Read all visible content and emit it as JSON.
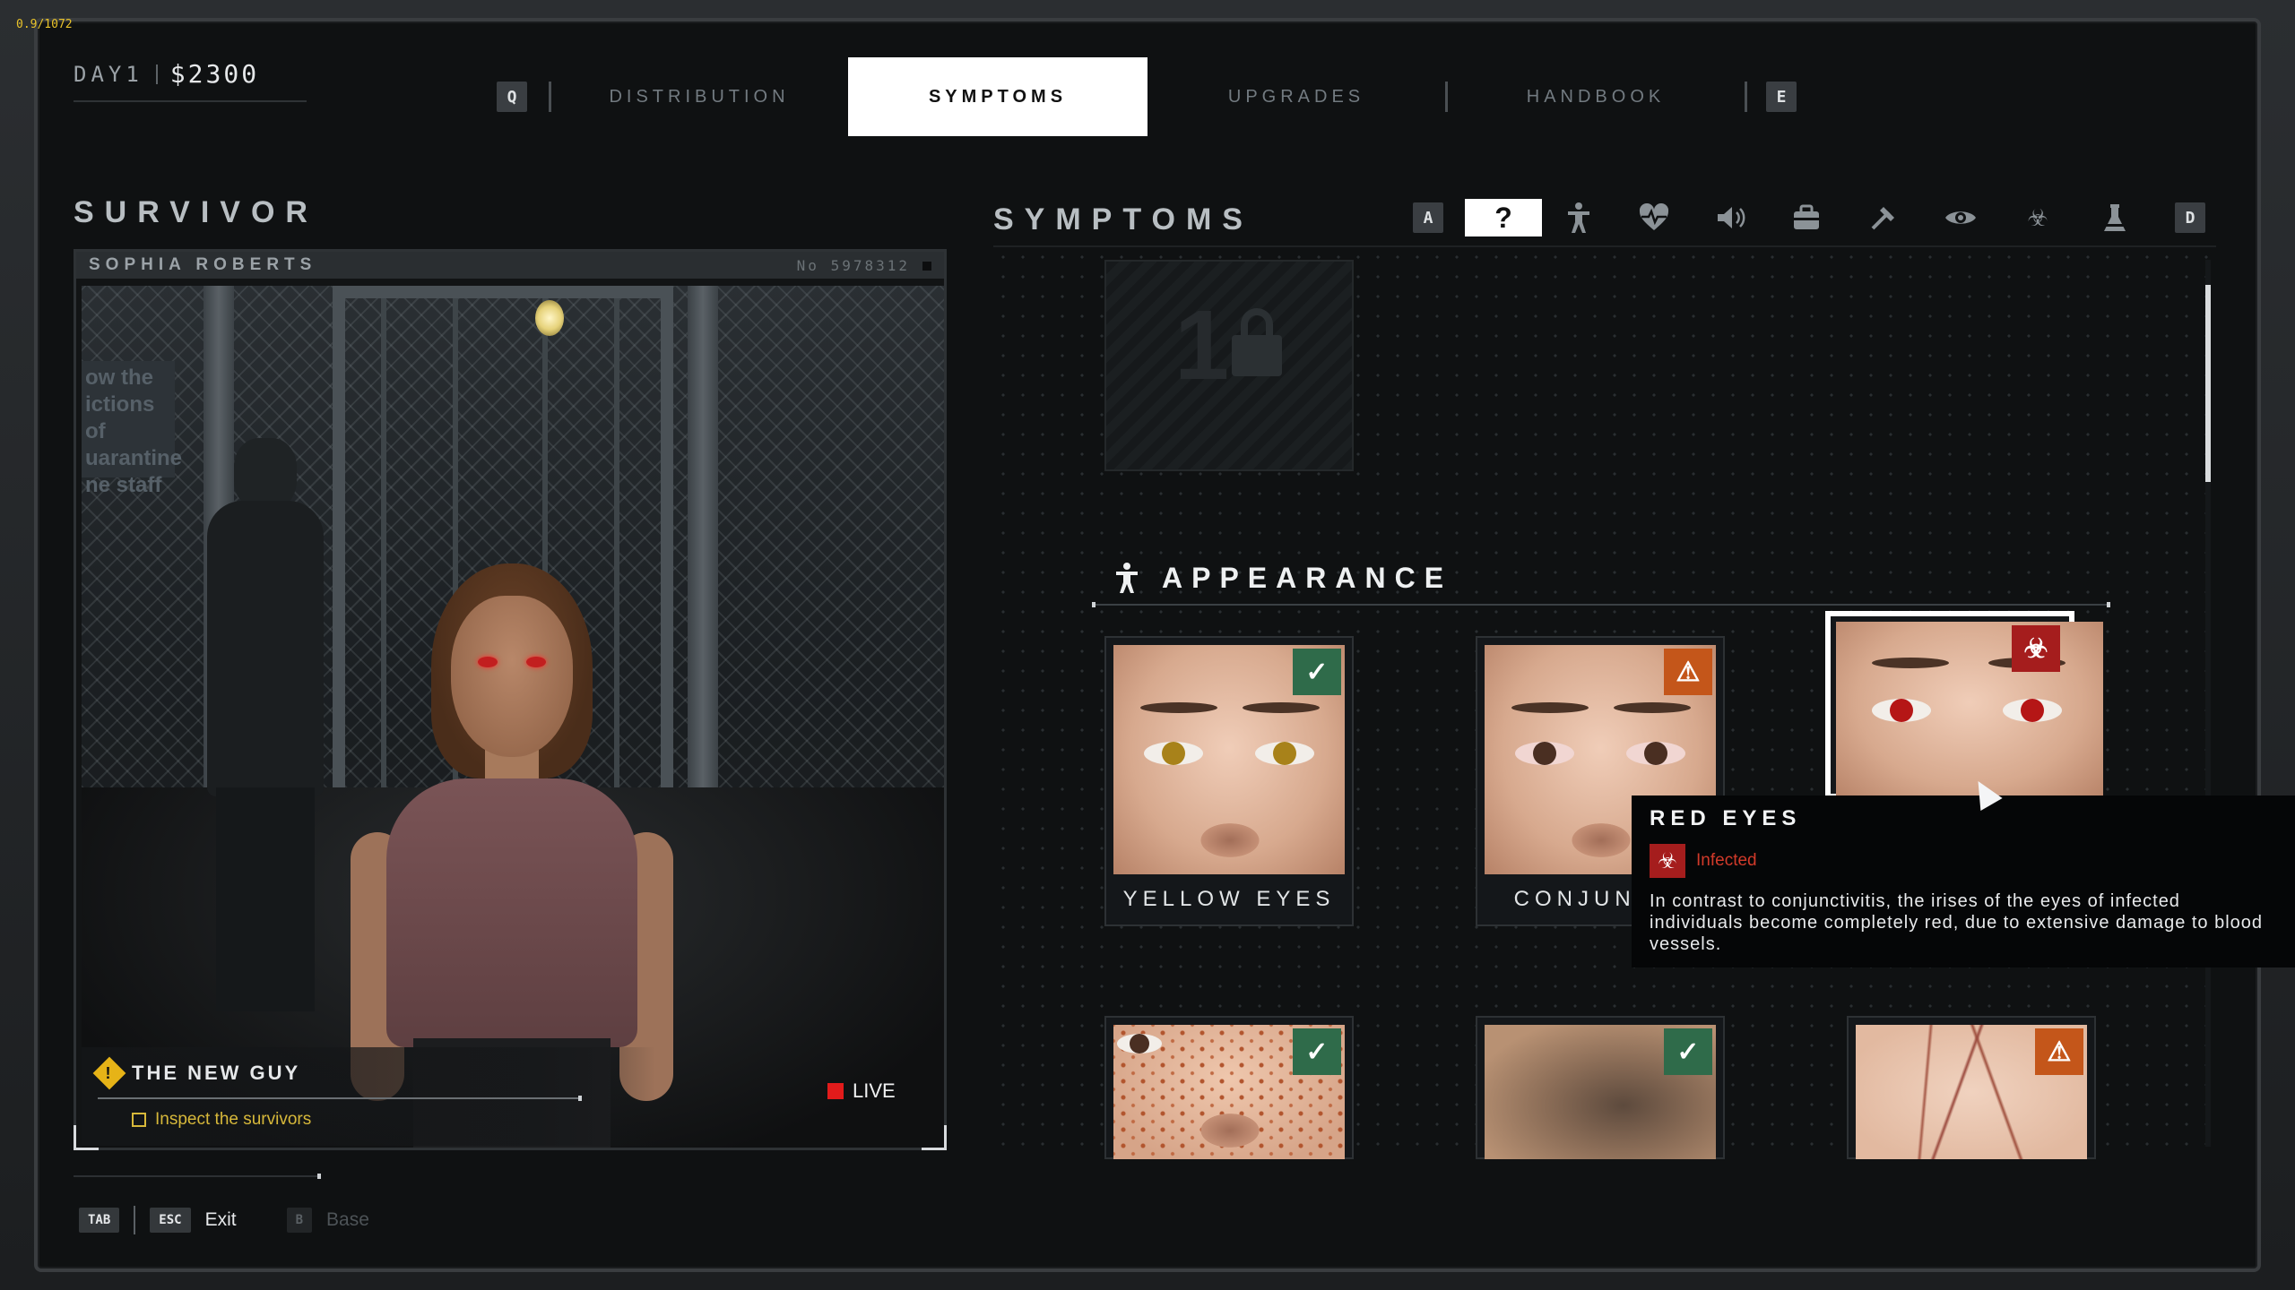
{
  "hud": {
    "fps": "0.9/1072",
    "day": "DAY1",
    "cash": "$2300"
  },
  "nav": {
    "key_prev": "Q",
    "key_next": "E",
    "tabs": [
      {
        "label": "DISTRIBUTION",
        "active": false
      },
      {
        "label": "SYMPTOMS",
        "active": true
      },
      {
        "label": "UPGRADES",
        "active": false
      },
      {
        "label": "HANDBOOK",
        "active": false
      }
    ]
  },
  "survivor": {
    "section_title": "SURVIVOR",
    "name": "SOPHIA ROBERTS",
    "number": "No 5978312",
    "sign_text": "ow the ictions of uarantine ne staff",
    "quest": {
      "title": "THE NEW GUY",
      "task": "Inspect the survivors"
    },
    "live_label": "LIVE"
  },
  "symptoms": {
    "section_title": "SYMPTOMS",
    "key_prev": "A",
    "key_next": "D",
    "filters": [
      {
        "icon": "question-icon",
        "glyph": "?",
        "active": true
      },
      {
        "icon": "body-icon",
        "glyph": "🯅",
        "active": false
      },
      {
        "icon": "heartbeat-icon",
        "glyph": "♥",
        "active": false
      },
      {
        "icon": "sound-icon",
        "glyph": "🔊",
        "active": false
      },
      {
        "icon": "bag-icon",
        "glyph": "▣",
        "active": false
      },
      {
        "icon": "tools-icon",
        "glyph": "⚒",
        "active": false
      },
      {
        "icon": "eye-icon",
        "glyph": "◉",
        "active": false
      },
      {
        "icon": "biohazard-icon",
        "glyph": "☣",
        "active": false
      },
      {
        "icon": "flask-icon",
        "glyph": "⚗",
        "active": false
      }
    ],
    "locked_number": "1",
    "category": {
      "title": "APPEARANCE",
      "cards": [
        {
          "label": "YELLOW EYES",
          "status": "safe",
          "iris": "#a8821a",
          "selected": false
        },
        {
          "label": "CONJUNCTI",
          "status": "warning",
          "iris": "#4a2f22",
          "selected": false
        },
        {
          "label": "RED EYES",
          "status": "infected",
          "iris": "#b51616",
          "selected": true
        },
        {
          "label": "",
          "status": "safe",
          "selected": false
        },
        {
          "label": "",
          "status": "safe",
          "selected": false
        },
        {
          "label": "",
          "status": "warning",
          "selected": false
        }
      ]
    },
    "tooltip": {
      "title": "RED EYES",
      "status": "Infected",
      "description": "In contrast to conjunctivitis, the irises of the eyes of infected individuals become completely red, due to extensive damage to blood vessels."
    }
  },
  "footer": {
    "tab_key": "TAB",
    "esc_key": "ESC",
    "exit_label": "Exit",
    "base_key": "B",
    "base_label": "Base"
  },
  "colors": {
    "safe": "#2f6b4a",
    "warning": "#c4561a",
    "infected": "#a51d1d",
    "quest_yellow": "#d7b83a",
    "live_red": "#e21b1b"
  }
}
